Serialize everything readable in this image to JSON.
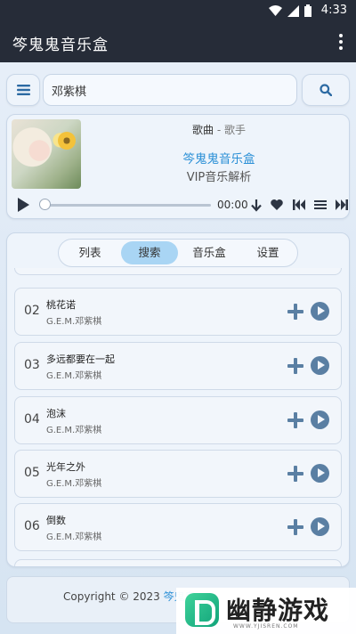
{
  "status_bar": {
    "time": "4:33"
  },
  "app": {
    "title": "笒鬼鬼音乐盒"
  },
  "search": {
    "value": "邓紫棋"
  },
  "player": {
    "song": "歌曲",
    "separator": "-",
    "artist": "歌手",
    "box_name": "笒鬼鬼音乐盒",
    "subtitle": "VIP音乐解析",
    "time": "00:00",
    "progress": 0
  },
  "tabs": [
    {
      "label": "列表",
      "active": false
    },
    {
      "label": "搜索",
      "active": true
    },
    {
      "label": "音乐盒",
      "active": false
    },
    {
      "label": "设置",
      "active": false
    }
  ],
  "songs": [
    {
      "num": "02",
      "name": "桃花诺",
      "artist": "G.E.M.邓紫棋"
    },
    {
      "num": "03",
      "name": "多远都要在一起",
      "artist": "G.E.M.邓紫棋"
    },
    {
      "num": "04",
      "name": "泡沫",
      "artist": "G.E.M.邓紫棋"
    },
    {
      "num": "05",
      "name": "光年之外",
      "artist": "G.E.M.邓紫棋"
    },
    {
      "num": "06",
      "name": "倒数",
      "artist": "G.E.M.邓紫棋"
    }
  ],
  "footer": {
    "copyright": "Copyright © 2023",
    "brand": "笒鬼鬼"
  },
  "watermark": {
    "text": "幽静游戏",
    "url": "WWW.YJISREN.COM"
  },
  "icons": {
    "menu": "hamburger-menu-icon",
    "search": "search-icon",
    "more": "more-vert-icon",
    "play": "play-icon",
    "download": "download-icon",
    "favorite": "heart-icon",
    "prev": "skip-previous-icon",
    "playlist": "playlist-icon",
    "next": "skip-next-icon",
    "add": "add-icon",
    "play_circle": "play-circle-icon"
  },
  "colors": {
    "appbar": "#262c38",
    "accent": "#2a8fd6",
    "tab_active": "#a9d5f4",
    "icon_action": "#5a7fa3"
  }
}
